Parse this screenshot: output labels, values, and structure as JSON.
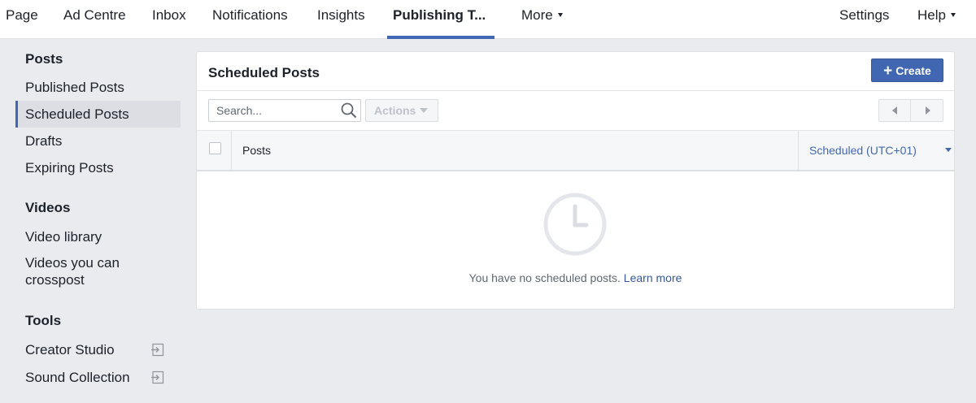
{
  "topnav": {
    "items": [
      "Page",
      "Ad Centre",
      "Inbox",
      "Notifications",
      "Insights",
      "Publishing T..."
    ],
    "more": "More",
    "settings": "Settings",
    "help": "Help"
  },
  "sidebar": {
    "sections": [
      {
        "heading": "Posts",
        "items": [
          "Published Posts",
          "Scheduled Posts",
          "Drafts",
          "Expiring Posts"
        ]
      },
      {
        "heading": "Videos",
        "items": [
          "Video library",
          "Videos you can",
          "crosspost"
        ]
      },
      {
        "heading": "Tools",
        "items": [
          "Creator Studio",
          "Sound Collection"
        ]
      }
    ],
    "selected": "Scheduled Posts"
  },
  "main": {
    "title": "Scheduled Posts",
    "create_label": "Create",
    "search_placeholder": "Search...",
    "actions_label": "Actions",
    "table": {
      "columns": [
        "Posts",
        "Scheduled (UTC+01)"
      ]
    },
    "empty": {
      "message": "You have no scheduled posts.",
      "link": "Learn more"
    }
  },
  "colors": {
    "accent": "#4267b2",
    "background": "#e9ebee",
    "link": "#385898"
  },
  "icons": [
    "search-icon",
    "clock-icon",
    "external-link-icon",
    "chevron-left-icon",
    "chevron-right-icon",
    "plus-icon",
    "caret-down-icon"
  ]
}
